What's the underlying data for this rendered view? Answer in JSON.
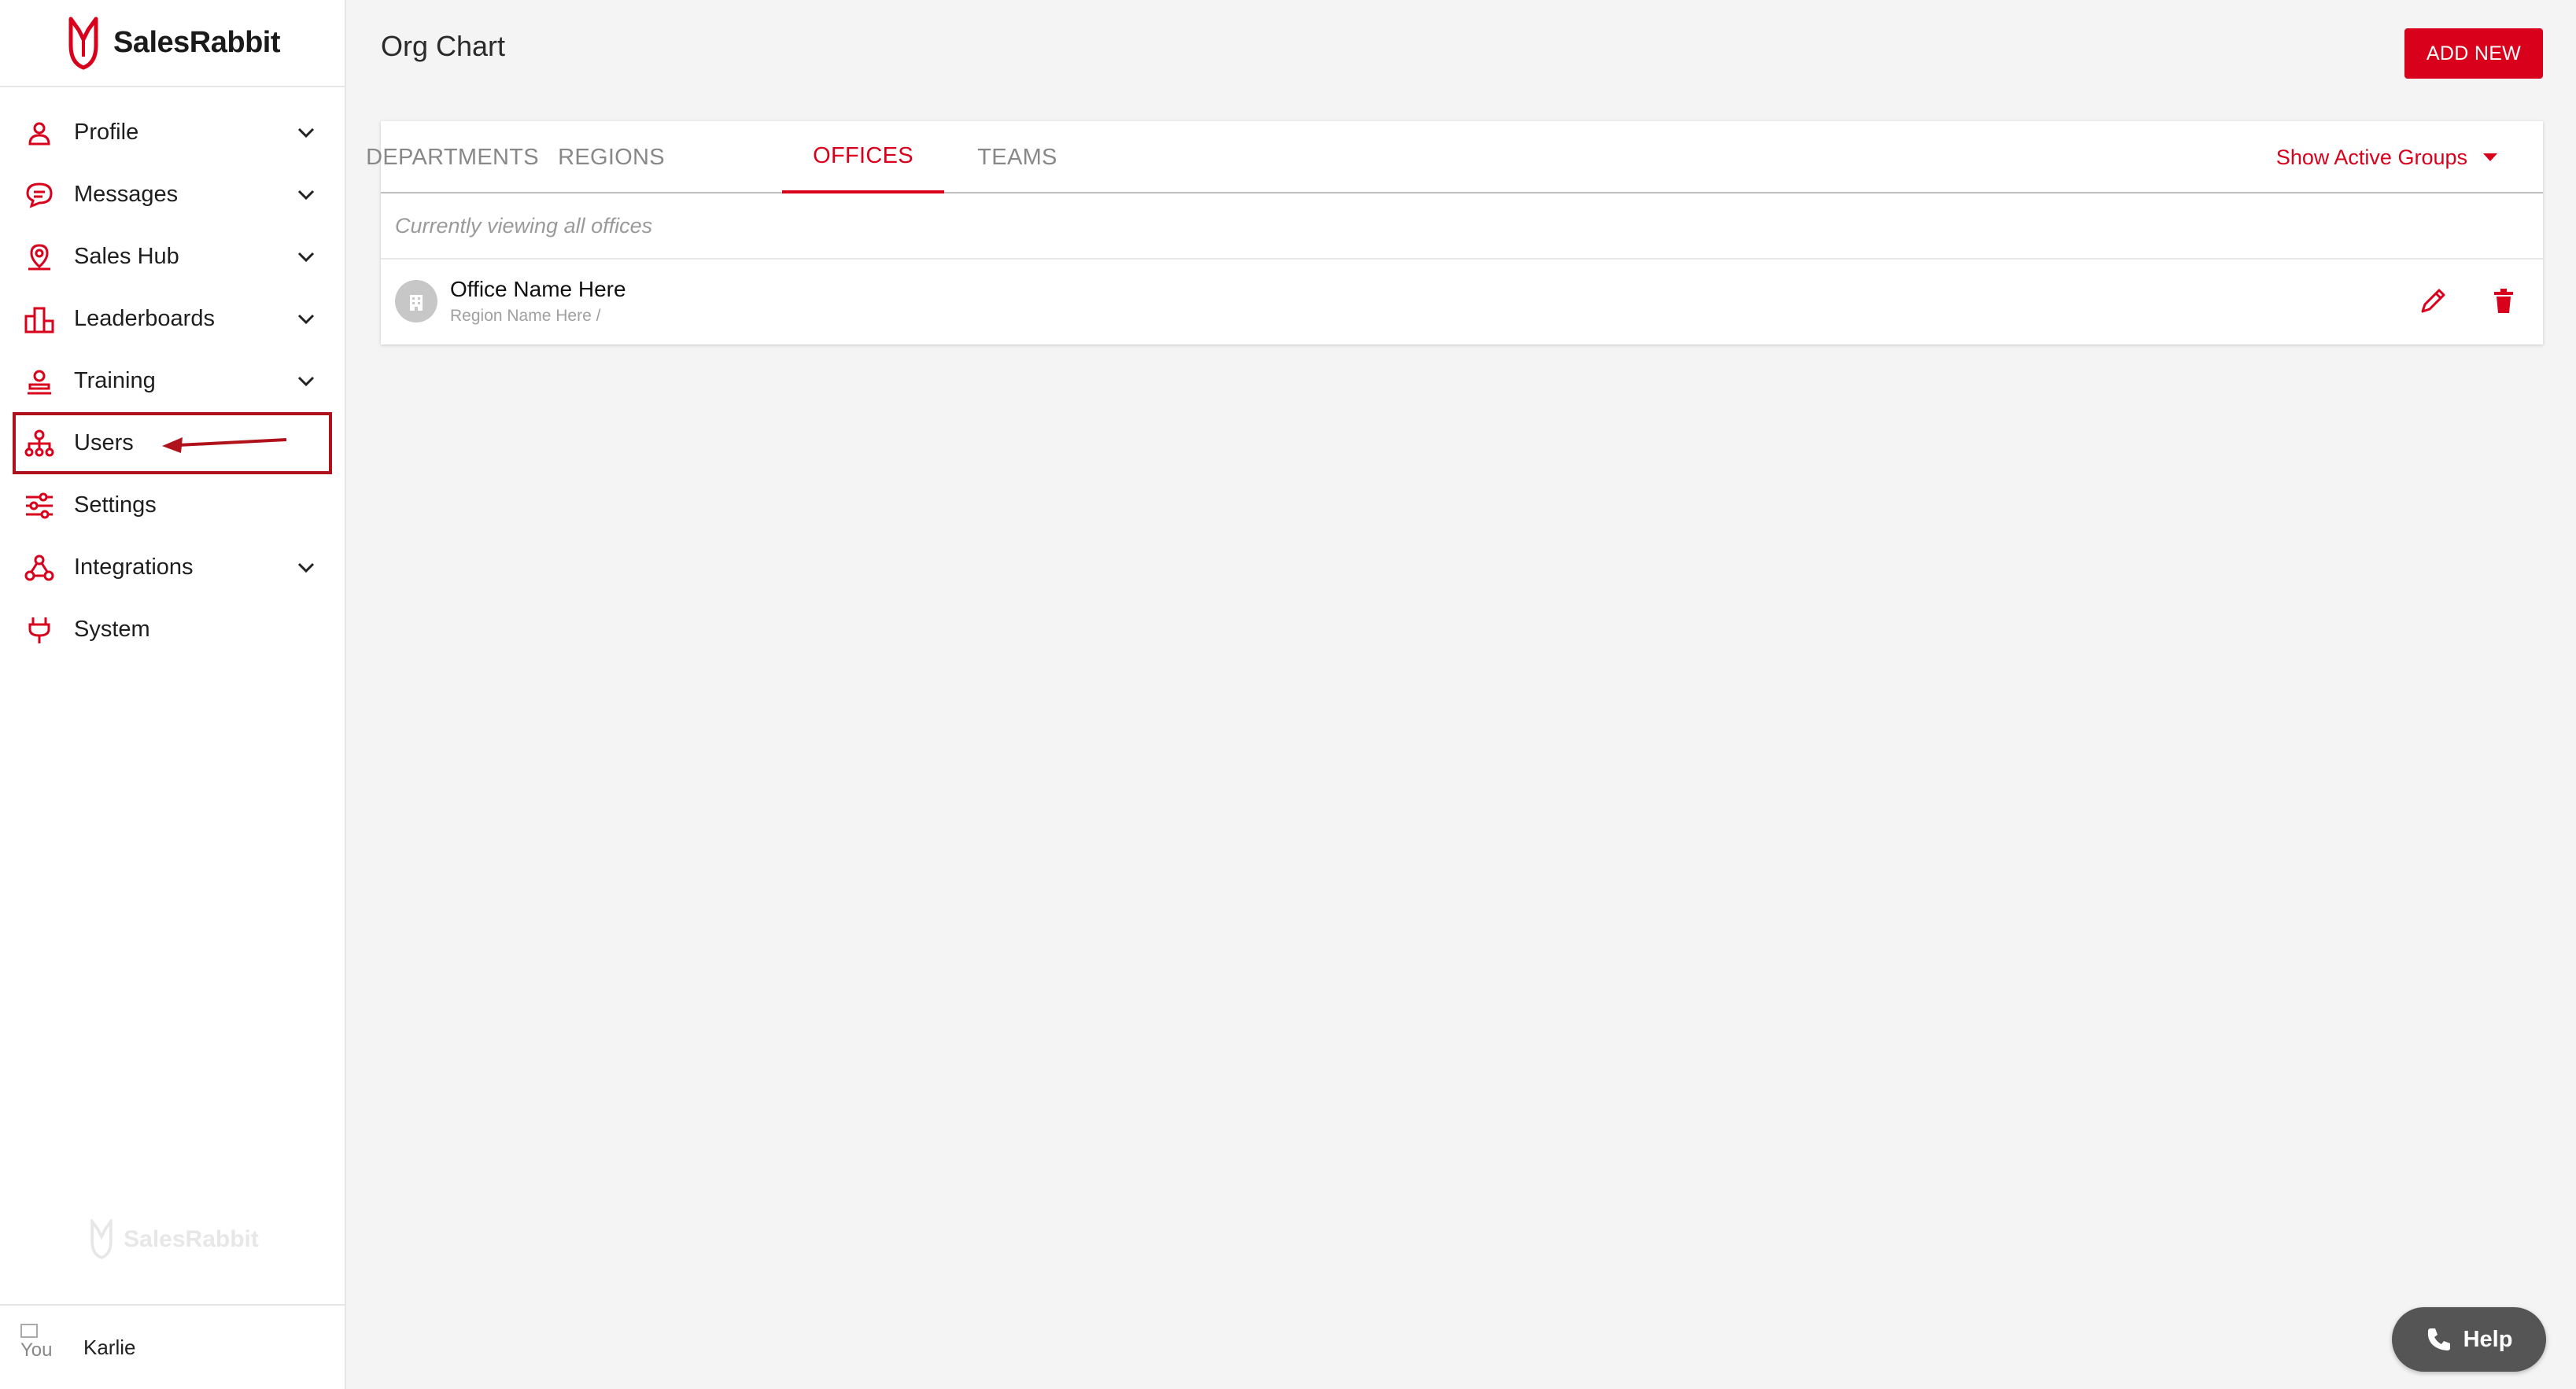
{
  "brand": {
    "name": "SalesRabbit",
    "accent": "#d9001b"
  },
  "sidebar": {
    "items": [
      {
        "label": "Profile",
        "icon": "person-icon",
        "has_chevron": true
      },
      {
        "label": "Messages",
        "icon": "chat-icon",
        "has_chevron": true
      },
      {
        "label": "Sales Hub",
        "icon": "map-pin-icon",
        "has_chevron": true
      },
      {
        "label": "Leaderboards",
        "icon": "podium-icon",
        "has_chevron": true
      },
      {
        "label": "Training",
        "icon": "training-icon",
        "has_chevron": true
      },
      {
        "label": "Users",
        "icon": "org-chart-icon",
        "has_chevron": false,
        "highlighted": true
      },
      {
        "label": "Settings",
        "icon": "sliders-icon",
        "has_chevron": false
      },
      {
        "label": "Integrations",
        "icon": "integrations-icon",
        "has_chevron": true
      },
      {
        "label": "System",
        "icon": "plug-icon",
        "has_chevron": false
      }
    ],
    "watermark": "SalesRabbit",
    "user": {
      "name": "Karlie",
      "avatar_alt": "You"
    }
  },
  "page": {
    "title": "Org Chart",
    "add_button": "ADD NEW"
  },
  "tabs": [
    {
      "label": "DEPARTMENTS",
      "active": false
    },
    {
      "label": "REGIONS",
      "active": false
    },
    {
      "label": "OFFICES",
      "active": true
    },
    {
      "label": "TEAMS",
      "active": false
    }
  ],
  "filter": {
    "label": "Show Active Groups"
  },
  "list": {
    "subheader": "Currently viewing all offices",
    "rows": [
      {
        "title": "Office Name Here",
        "subtitle": "Region Name Here /"
      }
    ]
  },
  "help": {
    "label": "Help"
  }
}
